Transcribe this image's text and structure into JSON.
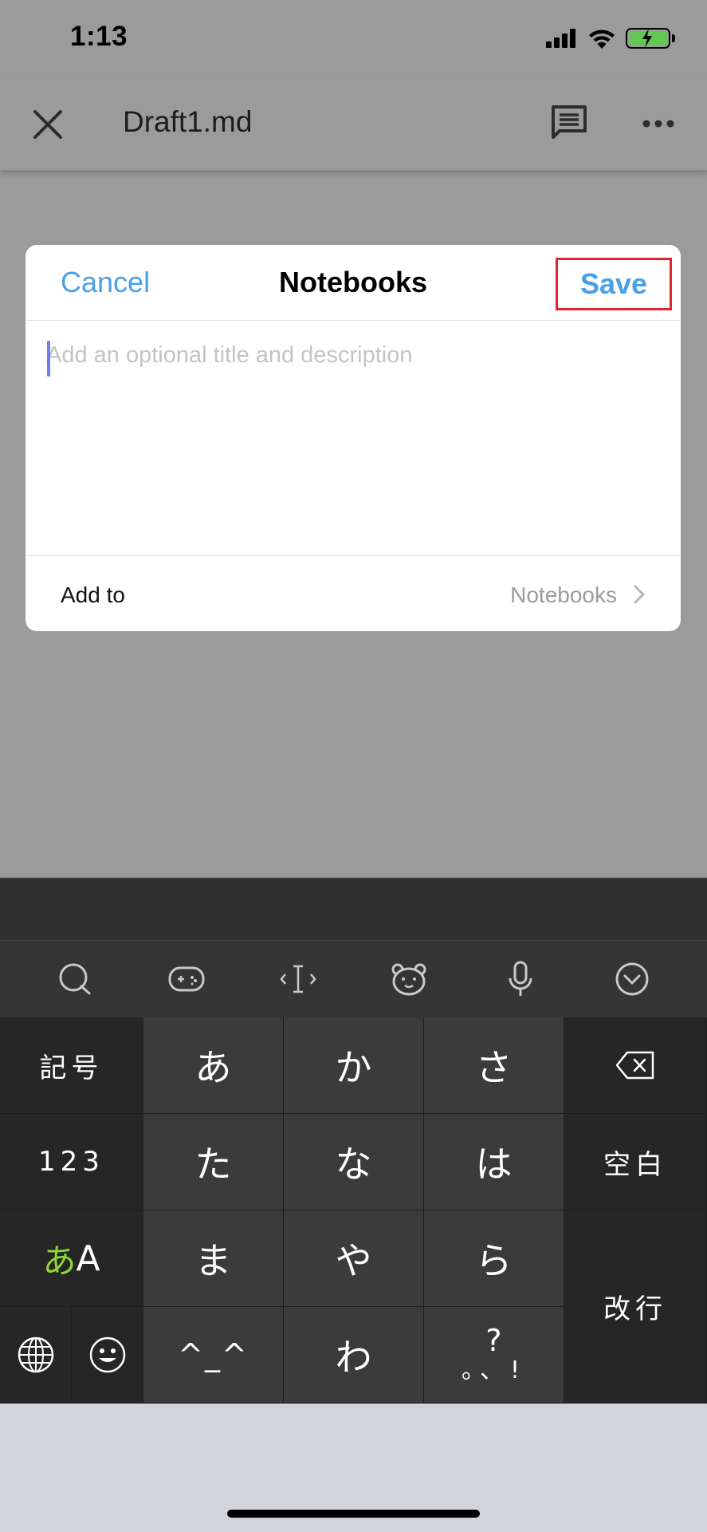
{
  "status_bar": {
    "time": "1:13"
  },
  "app_bar": {
    "title": "Draft1.md"
  },
  "dialog": {
    "cancel_label": "Cancel",
    "title": "Notebooks",
    "save_label": "Save",
    "description_placeholder": "Add an optional title and description",
    "description_value": "",
    "add_to_label": "Add to",
    "add_to_value": "Notebooks"
  },
  "keyboard": {
    "toolbar_icons": [
      "search-icon",
      "game-icon",
      "cursor-icon",
      "bear-face-icon",
      "microphone-icon",
      "collapse-icon"
    ],
    "keys": {
      "symbols": "記号",
      "numbers": "123",
      "mode_kana": "あ",
      "mode_latin": "A",
      "a": "あ",
      "ka": "か",
      "sa": "さ",
      "ta": "た",
      "na": "な",
      "ha": "は",
      "ma": "ま",
      "ya": "や",
      "ra": "ら",
      "emoticon": "^_^",
      "wa": "わ",
      "punct_top": "?",
      "punct_bottom": "。、!",
      "space": "空白",
      "enter": "改行"
    }
  },
  "colors": {
    "accent": "#4aa0e6",
    "highlight_border": "#e0262c",
    "battery_fill": "#62c554",
    "kana_mode": "#8ed63c"
  }
}
